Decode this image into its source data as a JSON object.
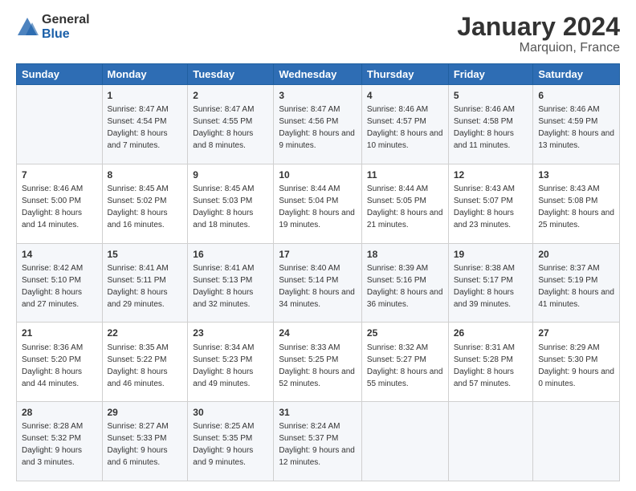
{
  "logo": {
    "general": "General",
    "blue": "Blue"
  },
  "title": "January 2024",
  "subtitle": "Marquion, France",
  "days_header": [
    "Sunday",
    "Monday",
    "Tuesday",
    "Wednesday",
    "Thursday",
    "Friday",
    "Saturday"
  ],
  "weeks": [
    [
      {
        "num": "",
        "sunrise": "",
        "sunset": "",
        "daylight": ""
      },
      {
        "num": "1",
        "sunrise": "Sunrise: 8:47 AM",
        "sunset": "Sunset: 4:54 PM",
        "daylight": "Daylight: 8 hours and 7 minutes."
      },
      {
        "num": "2",
        "sunrise": "Sunrise: 8:47 AM",
        "sunset": "Sunset: 4:55 PM",
        "daylight": "Daylight: 8 hours and 8 minutes."
      },
      {
        "num": "3",
        "sunrise": "Sunrise: 8:47 AM",
        "sunset": "Sunset: 4:56 PM",
        "daylight": "Daylight: 8 hours and 9 minutes."
      },
      {
        "num": "4",
        "sunrise": "Sunrise: 8:46 AM",
        "sunset": "Sunset: 4:57 PM",
        "daylight": "Daylight: 8 hours and 10 minutes."
      },
      {
        "num": "5",
        "sunrise": "Sunrise: 8:46 AM",
        "sunset": "Sunset: 4:58 PM",
        "daylight": "Daylight: 8 hours and 11 minutes."
      },
      {
        "num": "6",
        "sunrise": "Sunrise: 8:46 AM",
        "sunset": "Sunset: 4:59 PM",
        "daylight": "Daylight: 8 hours and 13 minutes."
      }
    ],
    [
      {
        "num": "7",
        "sunrise": "Sunrise: 8:46 AM",
        "sunset": "Sunset: 5:00 PM",
        "daylight": "Daylight: 8 hours and 14 minutes."
      },
      {
        "num": "8",
        "sunrise": "Sunrise: 8:45 AM",
        "sunset": "Sunset: 5:02 PM",
        "daylight": "Daylight: 8 hours and 16 minutes."
      },
      {
        "num": "9",
        "sunrise": "Sunrise: 8:45 AM",
        "sunset": "Sunset: 5:03 PM",
        "daylight": "Daylight: 8 hours and 18 minutes."
      },
      {
        "num": "10",
        "sunrise": "Sunrise: 8:44 AM",
        "sunset": "Sunset: 5:04 PM",
        "daylight": "Daylight: 8 hours and 19 minutes."
      },
      {
        "num": "11",
        "sunrise": "Sunrise: 8:44 AM",
        "sunset": "Sunset: 5:05 PM",
        "daylight": "Daylight: 8 hours and 21 minutes."
      },
      {
        "num": "12",
        "sunrise": "Sunrise: 8:43 AM",
        "sunset": "Sunset: 5:07 PM",
        "daylight": "Daylight: 8 hours and 23 minutes."
      },
      {
        "num": "13",
        "sunrise": "Sunrise: 8:43 AM",
        "sunset": "Sunset: 5:08 PM",
        "daylight": "Daylight: 8 hours and 25 minutes."
      }
    ],
    [
      {
        "num": "14",
        "sunrise": "Sunrise: 8:42 AM",
        "sunset": "Sunset: 5:10 PM",
        "daylight": "Daylight: 8 hours and 27 minutes."
      },
      {
        "num": "15",
        "sunrise": "Sunrise: 8:41 AM",
        "sunset": "Sunset: 5:11 PM",
        "daylight": "Daylight: 8 hours and 29 minutes."
      },
      {
        "num": "16",
        "sunrise": "Sunrise: 8:41 AM",
        "sunset": "Sunset: 5:13 PM",
        "daylight": "Daylight: 8 hours and 32 minutes."
      },
      {
        "num": "17",
        "sunrise": "Sunrise: 8:40 AM",
        "sunset": "Sunset: 5:14 PM",
        "daylight": "Daylight: 8 hours and 34 minutes."
      },
      {
        "num": "18",
        "sunrise": "Sunrise: 8:39 AM",
        "sunset": "Sunset: 5:16 PM",
        "daylight": "Daylight: 8 hours and 36 minutes."
      },
      {
        "num": "19",
        "sunrise": "Sunrise: 8:38 AM",
        "sunset": "Sunset: 5:17 PM",
        "daylight": "Daylight: 8 hours and 39 minutes."
      },
      {
        "num": "20",
        "sunrise": "Sunrise: 8:37 AM",
        "sunset": "Sunset: 5:19 PM",
        "daylight": "Daylight: 8 hours and 41 minutes."
      }
    ],
    [
      {
        "num": "21",
        "sunrise": "Sunrise: 8:36 AM",
        "sunset": "Sunset: 5:20 PM",
        "daylight": "Daylight: 8 hours and 44 minutes."
      },
      {
        "num": "22",
        "sunrise": "Sunrise: 8:35 AM",
        "sunset": "Sunset: 5:22 PM",
        "daylight": "Daylight: 8 hours and 46 minutes."
      },
      {
        "num": "23",
        "sunrise": "Sunrise: 8:34 AM",
        "sunset": "Sunset: 5:23 PM",
        "daylight": "Daylight: 8 hours and 49 minutes."
      },
      {
        "num": "24",
        "sunrise": "Sunrise: 8:33 AM",
        "sunset": "Sunset: 5:25 PM",
        "daylight": "Daylight: 8 hours and 52 minutes."
      },
      {
        "num": "25",
        "sunrise": "Sunrise: 8:32 AM",
        "sunset": "Sunset: 5:27 PM",
        "daylight": "Daylight: 8 hours and 55 minutes."
      },
      {
        "num": "26",
        "sunrise": "Sunrise: 8:31 AM",
        "sunset": "Sunset: 5:28 PM",
        "daylight": "Daylight: 8 hours and 57 minutes."
      },
      {
        "num": "27",
        "sunrise": "Sunrise: 8:29 AM",
        "sunset": "Sunset: 5:30 PM",
        "daylight": "Daylight: 9 hours and 0 minutes."
      }
    ],
    [
      {
        "num": "28",
        "sunrise": "Sunrise: 8:28 AM",
        "sunset": "Sunset: 5:32 PM",
        "daylight": "Daylight: 9 hours and 3 minutes."
      },
      {
        "num": "29",
        "sunrise": "Sunrise: 8:27 AM",
        "sunset": "Sunset: 5:33 PM",
        "daylight": "Daylight: 9 hours and 6 minutes."
      },
      {
        "num": "30",
        "sunrise": "Sunrise: 8:25 AM",
        "sunset": "Sunset: 5:35 PM",
        "daylight": "Daylight: 9 hours and 9 minutes."
      },
      {
        "num": "31",
        "sunrise": "Sunrise: 8:24 AM",
        "sunset": "Sunset: 5:37 PM",
        "daylight": "Daylight: 9 hours and 12 minutes."
      },
      {
        "num": "",
        "sunrise": "",
        "sunset": "",
        "daylight": ""
      },
      {
        "num": "",
        "sunrise": "",
        "sunset": "",
        "daylight": ""
      },
      {
        "num": "",
        "sunrise": "",
        "sunset": "",
        "daylight": ""
      }
    ]
  ]
}
